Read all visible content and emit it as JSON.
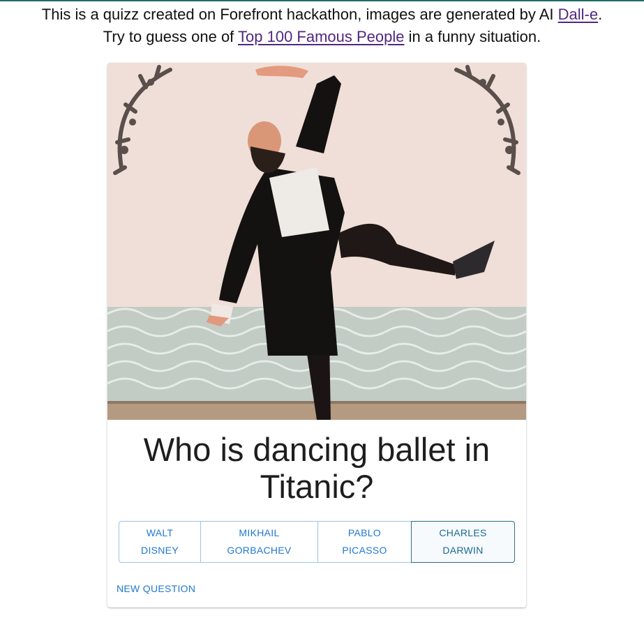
{
  "intro": {
    "line1_before": "This is a quizz created on Forefront hackathon, images are generated by AI ",
    "line1_link": "Dall-e",
    "line1_after": ".",
    "line2_before": "Try to guess one of ",
    "line2_link": "Top 100 Famous People",
    "line2_after": " in a funny situation."
  },
  "quiz": {
    "question": "Who is dancing ballet in Titanic?",
    "answers": [
      {
        "line1": "WALT",
        "line2": "DISNEY"
      },
      {
        "line1": "MIKHAIL",
        "line2": "GORBACHEV"
      },
      {
        "line1": "PABLO",
        "line2": "PICASSO"
      },
      {
        "line1": "CHARLES",
        "line2": "DARWIN"
      }
    ],
    "selected_answer": "CHARLES DARWIN",
    "new_question_label": "NEW QUESTION"
  },
  "colors": {
    "link": "#52277f",
    "accent": "#1f78d1",
    "top_border": "#1f6b67",
    "image_background": "#efdfd8",
    "sea": "#bfc7bf"
  },
  "icons": {
    "generated_image": "ai-generated-ballet-dancer-image"
  }
}
